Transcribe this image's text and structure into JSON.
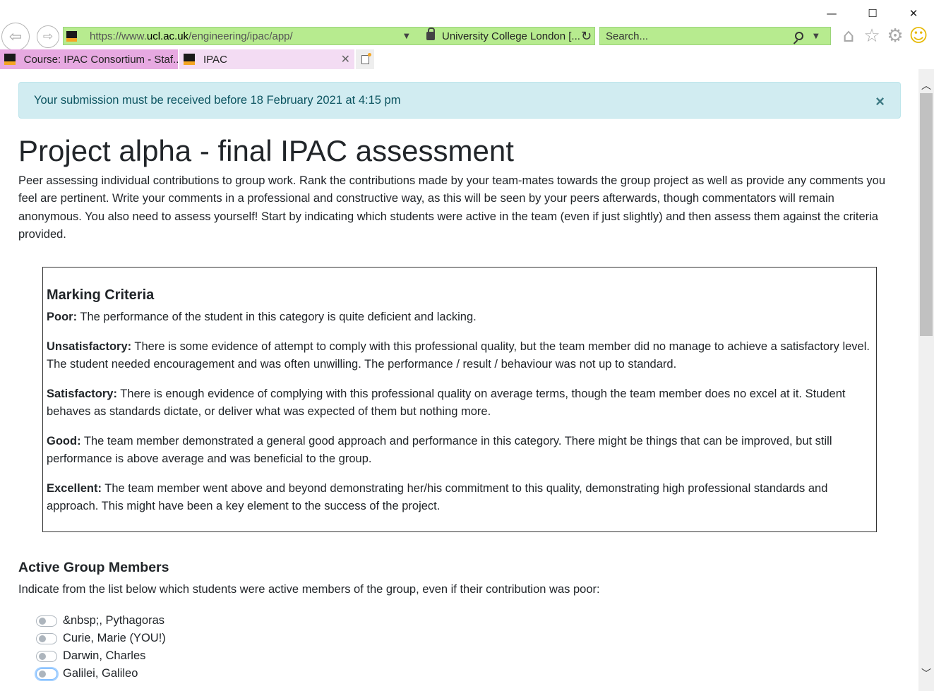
{
  "browser": {
    "url_prefix": "https://www.",
    "url_domain": "ucl.ac.uk",
    "url_path": "/engineering/ipac/app/",
    "site_identity": "University College London [...",
    "search_placeholder": "Search...",
    "tabs": [
      {
        "label": "Course: IPAC Consortium - Staf..."
      },
      {
        "label": "IPAC"
      }
    ]
  },
  "alert": {
    "message": "Your submission must be received before 18 February 2021 at 4:15 pm",
    "close": "×"
  },
  "page": {
    "title": "Project alpha - final IPAC assessment",
    "intro": "Peer assessing individual contributions to group work. Rank the contributions made by your team-mates towards the group project as well as provide any comments you feel are pertinent. Write your comments in a professional and constructive way, as this will be seen by your peers afterwards, though commentators will remain anonymous. You also need to assess yourself! Start by indicating which students were active in the team (even if just slightly) and then assess them against the criteria provided."
  },
  "criteria": {
    "title": "Marking Criteria",
    "items": [
      {
        "name": "Poor:",
        "text": " The performance of the student in this category is quite deficient and lacking."
      },
      {
        "name": "Unsatisfactory:",
        "text": " There is some evidence of attempt to comply with this professional quality, but the team member did no manage to achieve a satisfactory level. The student needed encouragement and was often unwilling. The performance / result / behaviour was not up to standard."
      },
      {
        "name": "Satisfactory:",
        "text": " There is enough evidence of complying with this professional quality on average terms, though the team member does no excel at it. Student behaves as standards dictate, or deliver what was expected of them but nothing more."
      },
      {
        "name": "Good:",
        "text": " The team member demonstrated a general good approach and performance in this category. There might be things that can be improved, but still performance is above average and was beneficial to the group."
      },
      {
        "name": "Excellent:",
        "text": " The team member went above and beyond demonstrating her/his commitment to this quality, demonstrating high professional standards and approach. This might have been a key element to the success of the project."
      }
    ]
  },
  "members": {
    "title": "Active Group Members",
    "description": "Indicate from the list below which students were active members of the group, even if their contribution was poor:",
    "list": [
      {
        "label": "&nbsp;, Pythagoras",
        "active": false
      },
      {
        "label": "Curie, Marie (YOU!)",
        "active": false
      },
      {
        "label": "Darwin, Charles",
        "active": false
      },
      {
        "label": "Galilei, Galileo",
        "active": false
      }
    ]
  }
}
